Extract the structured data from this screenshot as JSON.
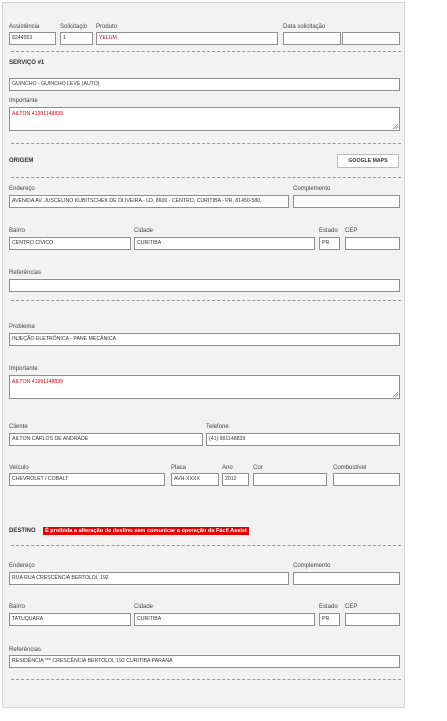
{
  "header": {
    "assistencia_label": "Assistência",
    "assistencia_value": "8244553",
    "solicitacao_label": "Solicitaçio",
    "solicitacao_value": "1",
    "produto_label": "Produto",
    "produto_value": "YELUM",
    "data_label": "Data solicitação",
    "data_value": "",
    "hora_value": ""
  },
  "servico": {
    "title": "SERVIÇO #1",
    "servico_value": "GUINCHO - GUINCHO LEVE (AUTO)",
    "importante_label": "Importante",
    "importante_value": "AILTON 41991148839"
  },
  "origem": {
    "title": "ORIGEM",
    "maps_button": "GOOGLE MAPS",
    "endereco_label": "Endereço",
    "endereco_value": "AVENIDA AV. JUSCELINO KUBITSCHEK DE OLIVEIRA - LD, 8600 - CENTRO, CURITIBA - PR, 81450-580,",
    "complemento_label": "Complemento",
    "complemento_value": "",
    "bairro_label": "Bairro",
    "bairro_value": "CENTRO CÍVICO",
    "cidade_label": "Cidade",
    "cidade_value": "CURITIBA",
    "estado_label": "Estado",
    "estado_value": "PR",
    "cep_label": "CEP",
    "cep_value": "",
    "referencias_label": "Referências",
    "referencias_value": ""
  },
  "detalhes": {
    "problema_label": "Problema",
    "problema_value": "INJEÇÃO ELETRÔNICA - PANE MECÂNICA",
    "importante_label": "Importante",
    "importante_value": "AILTON 41991148839",
    "cliente_label": "Cliente",
    "cliente_value": "AILTON CARLOS DE ANDRADE",
    "telefone_label": "Telefone",
    "telefone_value": "(41) 991148839",
    "veiculo_label": "Veículo",
    "veiculo_value": "CHEVROLET / COBALT",
    "placa_label": "Placa",
    "placa_value": "AVH-XXXX",
    "ano_label": "Ano",
    "ano_value": "2012",
    "cor_label": "Cor",
    "cor_value": "",
    "combustivel_label": "Combustível",
    "combustivel_value": ""
  },
  "destino": {
    "title": "DESTINO",
    "warning": "É proibida a alteração de destino sem comunicar a operação da Fácil Assist",
    "endereco_label": "Endereço",
    "endereco_value": "RUA RUA CRESCÊNCIA BERTOLDI, 192",
    "complemento_label": "Complemento",
    "complemento_value": "",
    "bairro_label": "Bairro",
    "bairro_value": "TATUQUARA",
    "cidade_label": "Cidade",
    "cidade_value": "CURITIBA",
    "estado_label": "Estado",
    "estado_value": "PR",
    "cep_label": "CEP",
    "cep_value": "",
    "referencias_label": "Referências",
    "referencias_value": "RESIDÊNCIA *** CRESCÊNCIA BERTOLDI, 192 CURITIBA PARANÁ"
  },
  "colors": {
    "panel_bg": "#f2f2f2",
    "warning_bg": "#e60000",
    "highlight_text": "#dd0000"
  }
}
